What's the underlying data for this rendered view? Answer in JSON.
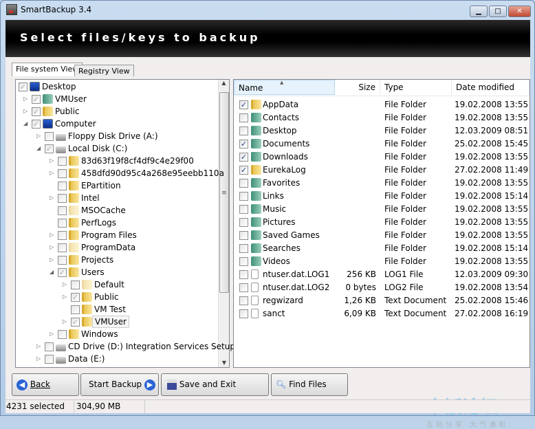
{
  "window": {
    "title": "SmartBackup 3.4",
    "minimize": "▁",
    "maximize": "□",
    "close": "✕"
  },
  "banner": {
    "heading": "Select files/keys to backup"
  },
  "tabs": [
    {
      "label": "File system View",
      "active": true
    },
    {
      "label": "Registry View",
      "active": false
    }
  ],
  "tree": [
    {
      "label": "Desktop",
      "level": 0,
      "expander": "none",
      "checked": "grey",
      "icon": "desktop"
    },
    {
      "label": "VMUser",
      "level": 1,
      "expander": "collapsed",
      "checked": "grey",
      "icon": "special"
    },
    {
      "label": "Public",
      "level": 1,
      "expander": "collapsed",
      "checked": "grey",
      "icon": "folder"
    },
    {
      "label": "Computer",
      "level": 1,
      "expander": "expanded",
      "checked": "grey",
      "icon": "computer"
    },
    {
      "label": "Floppy Disk Drive (A:)",
      "level": 2,
      "expander": "collapsed",
      "checked": "none",
      "icon": "drive"
    },
    {
      "label": "Local Disk (C:)",
      "level": 2,
      "expander": "expanded",
      "checked": "grey",
      "icon": "drive"
    },
    {
      "label": "83d63f19f8cf4df9c4e29f00",
      "level": 3,
      "expander": "collapsed",
      "checked": "none",
      "icon": "folder"
    },
    {
      "label": "458dfd90d95c4a268e95eebb110a",
      "level": 3,
      "expander": "collapsed",
      "checked": "none",
      "icon": "folder"
    },
    {
      "label": "EPartition",
      "level": 3,
      "expander": "none",
      "checked": "none",
      "icon": "folder"
    },
    {
      "label": "Intel",
      "level": 3,
      "expander": "collapsed",
      "checked": "none",
      "icon": "folder"
    },
    {
      "label": "MSOCache",
      "level": 3,
      "expander": "none",
      "checked": "none",
      "icon": "folder-pale"
    },
    {
      "label": "PerfLogs",
      "level": 3,
      "expander": "none",
      "checked": "none",
      "icon": "folder"
    },
    {
      "label": "Program Files",
      "level": 3,
      "expander": "collapsed",
      "checked": "none",
      "icon": "folder"
    },
    {
      "label": "ProgramData",
      "level": 3,
      "expander": "collapsed",
      "checked": "none",
      "icon": "folder-pale"
    },
    {
      "label": "Projects",
      "level": 3,
      "expander": "collapsed",
      "checked": "none",
      "icon": "folder"
    },
    {
      "label": "Users",
      "level": 3,
      "expander": "expanded",
      "checked": "grey",
      "icon": "folder"
    },
    {
      "label": "Default",
      "level": 4,
      "expander": "collapsed",
      "checked": "none",
      "icon": "folder-pale"
    },
    {
      "label": "Public",
      "level": 4,
      "expander": "collapsed",
      "checked": "grey",
      "icon": "folder"
    },
    {
      "label": "VM Test",
      "level": 4,
      "expander": "none",
      "checked": "none",
      "icon": "folder"
    },
    {
      "label": "VMUser",
      "level": 4,
      "expander": "collapsed",
      "checked": "grey",
      "icon": "folder",
      "selected": true
    },
    {
      "label": "Windows",
      "level": 3,
      "expander": "collapsed",
      "checked": "none",
      "icon": "folder"
    },
    {
      "label": "CD Drive (D:) Integration Services Setup",
      "level": 2,
      "expander": "collapsed",
      "checked": "none",
      "icon": "drive"
    },
    {
      "label": "Data (E:)",
      "level": 2,
      "expander": "collapsed",
      "checked": "none",
      "icon": "drive"
    }
  ],
  "list": {
    "columns": {
      "name": "Name",
      "size": "Size",
      "type": "Type",
      "date": "Date modified"
    },
    "sort_indicator": "▲",
    "rows": [
      {
        "name": "AppData",
        "size": "",
        "type": "File Folder",
        "date": "19.02.2008 13:55",
        "checked": true,
        "icon": "folder"
      },
      {
        "name": "Contacts",
        "size": "",
        "type": "File Folder",
        "date": "19.02.2008 13:55",
        "checked": false,
        "icon": "special"
      },
      {
        "name": "Desktop",
        "size": "",
        "type": "File Folder",
        "date": "12.03.2009 08:51",
        "checked": false,
        "icon": "special"
      },
      {
        "name": "Documents",
        "size": "",
        "type": "File Folder",
        "date": "25.02.2008 15:45",
        "checked": true,
        "icon": "special"
      },
      {
        "name": "Downloads",
        "size": "",
        "type": "File Folder",
        "date": "19.02.2008 13:55",
        "checked": true,
        "icon": "special"
      },
      {
        "name": "EurekaLog",
        "size": "",
        "type": "File Folder",
        "date": "27.02.2008 11:49",
        "checked": true,
        "icon": "folder"
      },
      {
        "name": "Favorites",
        "size": "",
        "type": "File Folder",
        "date": "19.02.2008 13:55",
        "checked": false,
        "icon": "special"
      },
      {
        "name": "Links",
        "size": "",
        "type": "File Folder",
        "date": "19.02.2008 15:14",
        "checked": false,
        "icon": "special"
      },
      {
        "name": "Music",
        "size": "",
        "type": "File Folder",
        "date": "19.02.2008 13:55",
        "checked": false,
        "icon": "special"
      },
      {
        "name": "Pictures",
        "size": "",
        "type": "File Folder",
        "date": "19.02.2008 13:55",
        "checked": false,
        "icon": "special"
      },
      {
        "name": "Saved Games",
        "size": "",
        "type": "File Folder",
        "date": "19.02.2008 13:55",
        "checked": false,
        "icon": "special"
      },
      {
        "name": "Searches",
        "size": "",
        "type": "File Folder",
        "date": "19.02.2008 15:14",
        "checked": false,
        "icon": "special"
      },
      {
        "name": "Videos",
        "size": "",
        "type": "File Folder",
        "date": "19.02.2008 13:55",
        "checked": false,
        "icon": "special"
      },
      {
        "name": "ntuser.dat.LOG1",
        "size": "256 KB",
        "type": "LOG1 File",
        "date": "12.03.2009 09:30",
        "checked": false,
        "icon": "file"
      },
      {
        "name": "ntuser.dat.LOG2",
        "size": "0 bytes",
        "type": "LOG2 File",
        "date": "19.02.2008 13:54",
        "checked": false,
        "icon": "file"
      },
      {
        "name": "regwizard",
        "size": "1,26 KB",
        "type": "Text Document",
        "date": "25.02.2008 15:46",
        "checked": false,
        "icon": "file"
      },
      {
        "name": "sanct",
        "size": "6,09 KB",
        "type": "Text Document",
        "date": "27.02.2008 16:19",
        "checked": false,
        "icon": "file"
      }
    ]
  },
  "buttons": {
    "back": "Back",
    "start": "Start Backup",
    "save": "Save and Exit",
    "find": "Find Files"
  },
  "status": {
    "selected": "4231 selected",
    "size": "304,90 MB"
  },
  "watermark": {
    "main": "卡饭论坛",
    "sub": "互助分享  大气谦和"
  }
}
